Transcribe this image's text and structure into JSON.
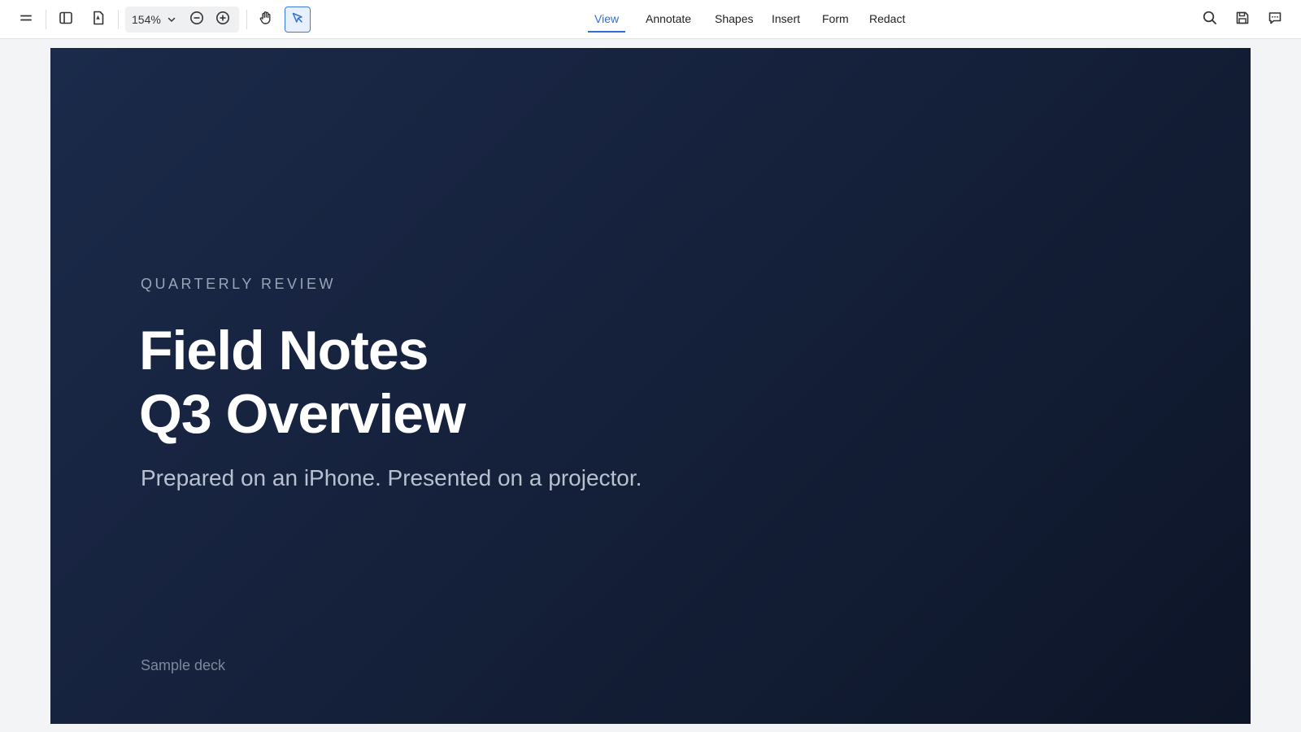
{
  "toolbar": {
    "zoom_value": "154%",
    "icons": [
      "menu-icon",
      "sidebar-panel-icon",
      "document-icon",
      "chevron-down-icon",
      "zoom-out-icon",
      "zoom-in-icon",
      "hand-tool-icon",
      "select-pointer-icon",
      "search-icon",
      "save-icon",
      "comment-icon"
    ],
    "accent_color": "#2f6fd6"
  },
  "tabs": [
    {
      "label": "View",
      "active": true
    },
    {
      "label": "Annotate",
      "active": false
    },
    {
      "label": "Shapes",
      "active": false
    },
    {
      "label": "Insert",
      "active": false
    },
    {
      "label": "Form",
      "active": false
    },
    {
      "label": "Redact",
      "active": false
    }
  ],
  "slide": {
    "eyebrow": "QUARTERLY REVIEW",
    "title_line1": "Field Notes",
    "title_line2": "Q3 Overview",
    "subtitle": "Prepared on an iPhone. Presented on a projector.",
    "footer": "Sample deck",
    "background_color": "#16223d"
  }
}
